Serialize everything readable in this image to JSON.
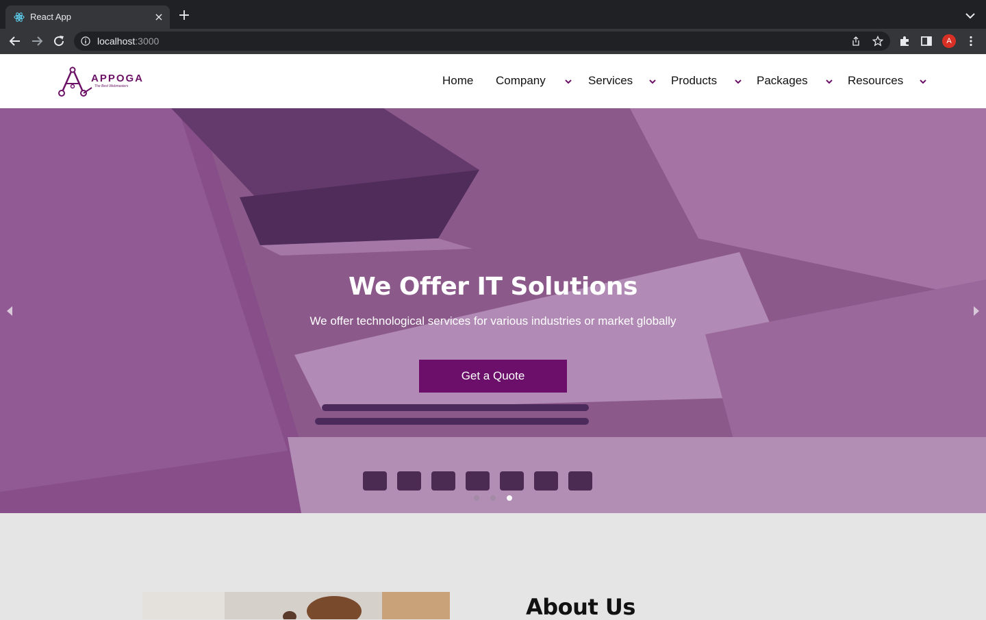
{
  "browser": {
    "tab_title": "React App",
    "url_host": "localhost",
    "url_port": ":3000",
    "profile_initial": "A"
  },
  "header": {
    "logo_text": "APPOGA",
    "logo_tagline": "The Best Webmasters",
    "nav": [
      {
        "label": "Home",
        "has_dropdown": false
      },
      {
        "label": "Company",
        "has_dropdown": true
      },
      {
        "label": "Services",
        "has_dropdown": true
      },
      {
        "label": "Products",
        "has_dropdown": true
      },
      {
        "label": "Packages",
        "has_dropdown": true
      },
      {
        "label": "Resources",
        "has_dropdown": true
      }
    ]
  },
  "hero": {
    "title": "We Offer IT Solutions",
    "subtitle": "We offer technological services for various industries or market globally",
    "cta_label": "Get a Quote",
    "slide_count": 3,
    "active_slide": 3
  },
  "about": {
    "title": "About Us"
  },
  "colors": {
    "brand_purple": "#6b0f6a",
    "hero_tint": "#8d5e8e",
    "chrome_dark": "#202124",
    "chrome_toolbar": "#35363a",
    "section_bg": "#e5e5e5"
  }
}
